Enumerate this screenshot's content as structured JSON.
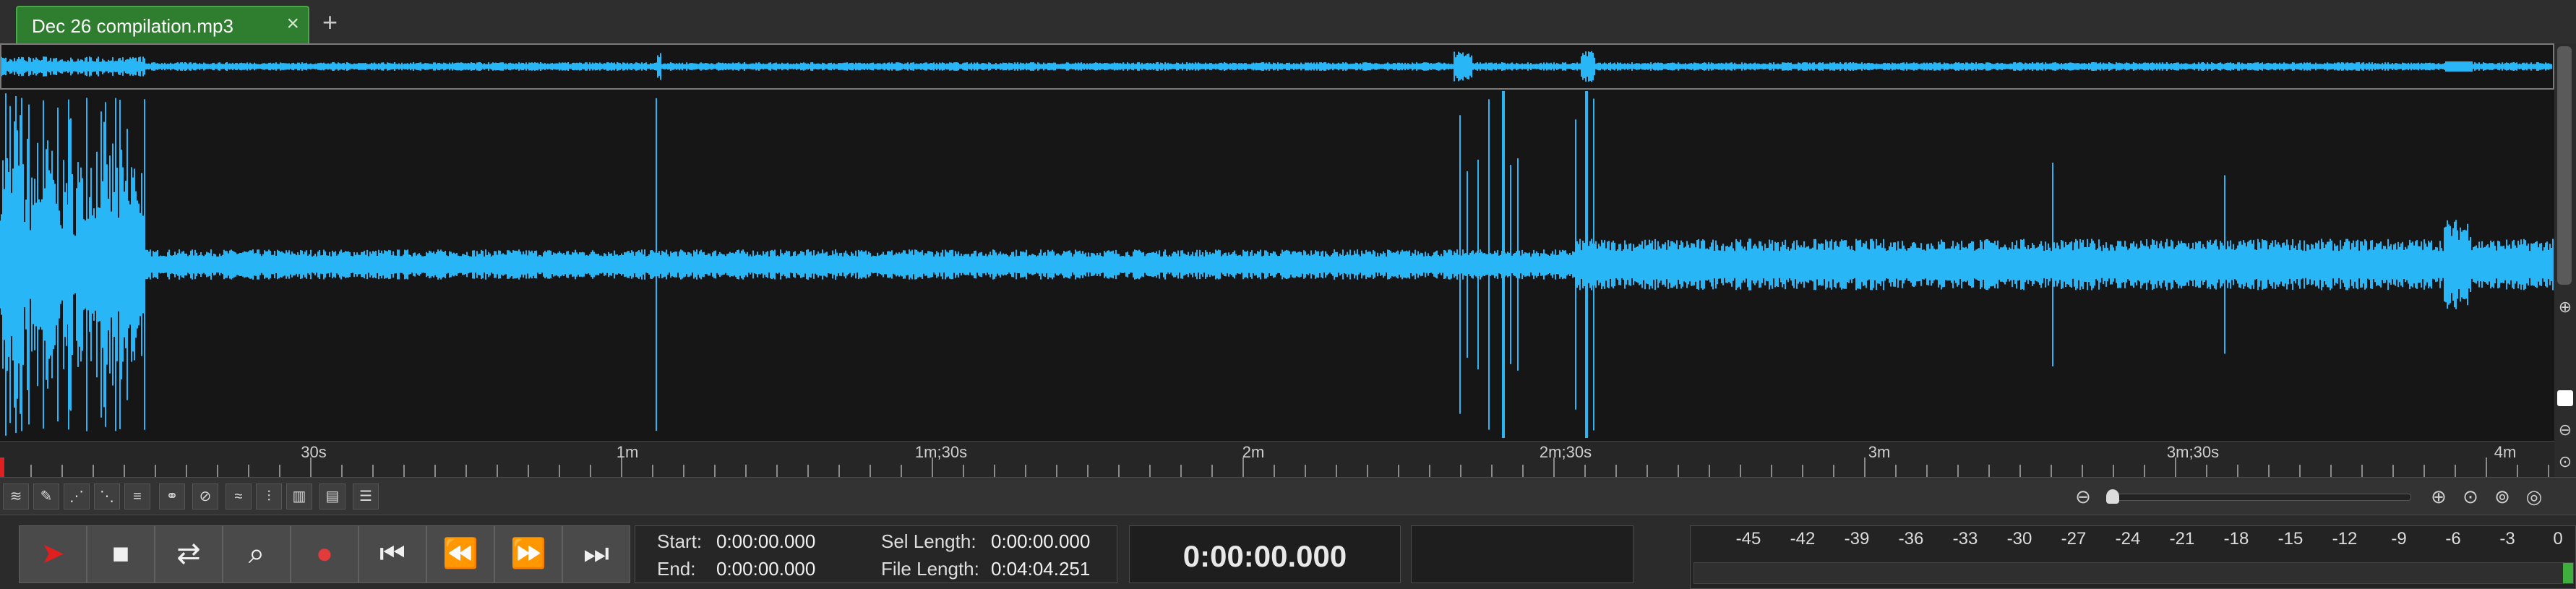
{
  "tab": {
    "label": "Dec 26 compilation.mp3",
    "close_glyph": "×",
    "add_glyph": "+"
  },
  "colors": {
    "waveform": "#29b6f6",
    "tab_active": "#2f7d2f",
    "playhead": "#e02020",
    "background": "#161616"
  },
  "timeline": {
    "ticks": [
      "30s",
      "1m",
      "1m;30s",
      "2m",
      "2m;30s",
      "3m",
      "3m;30s",
      "4m"
    ]
  },
  "tools": [
    "waveform-view-icon",
    "pencil-icon",
    "fade-in-icon",
    "fade-out-icon",
    "normalize-icon",
    "mix-icon",
    "no-snap-icon",
    "amplify-icon",
    "eq-icon",
    "spectrum-icon",
    "bars-icon",
    "list-icon"
  ],
  "transport": {
    "buttons": [
      "play-icon",
      "stop-icon",
      "loop-icon",
      "scrub-icon",
      "record-icon",
      "skip-start-icon",
      "rewind-icon",
      "fast-forward-icon",
      "skip-end-icon"
    ],
    "start_label": "Start:",
    "start_value": "0:00:00.000",
    "end_label": "End:",
    "end_value": "0:00:00.000",
    "sel_length_label": "Sel Length:",
    "sel_length_value": "0:00:00.000",
    "file_length_label": "File Length:",
    "file_length_value": "0:04:04.251",
    "time_display": "0:00:00.000"
  },
  "meter": {
    "ticks": [
      "-45",
      "-42",
      "-39",
      "-36",
      "-33",
      "-30",
      "-27",
      "-24",
      "-21",
      "-18",
      "-15",
      "-12",
      "-9",
      "-6",
      "-3",
      "0"
    ]
  }
}
